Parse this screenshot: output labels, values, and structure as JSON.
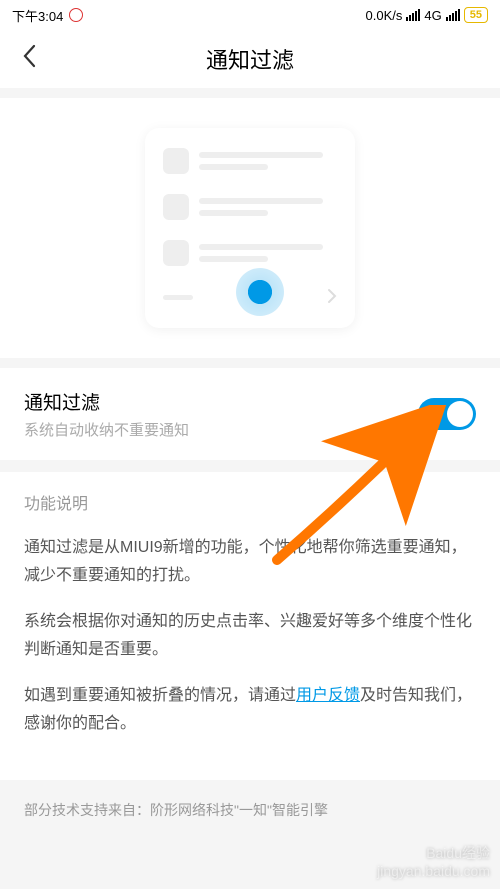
{
  "statusBar": {
    "time": "下午3:04",
    "speed": "0.0K/s",
    "network": "4G",
    "battery": "55"
  },
  "header": {
    "title": "通知过滤"
  },
  "setting": {
    "title": "通知过滤",
    "subtitle": "系统自动收纳不重要通知",
    "enabled": true
  },
  "sectionHeader": "功能说明",
  "description": {
    "para1": "通知过滤是从MIUI9新增的功能，个性化地帮你筛选重要通知，减少不重要通知的打扰。",
    "para2": "系统会根据你对通知的历史点击率、兴趣爱好等多个维度个性化判断通知是否重要。",
    "para3a": "如遇到重要通知被折叠的情况，请通过",
    "para3link": "用户反馈",
    "para3b": "及时告知我们，感谢你的配合。"
  },
  "footer": "部分技术支持来自：阶形网络科技\"一知\"智能引擎",
  "watermark": {
    "line1": "Baidu经验",
    "line2": "jingyan.baidu.com"
  },
  "colors": {
    "accent": "#0099e6",
    "arrow": "#ff7700"
  }
}
